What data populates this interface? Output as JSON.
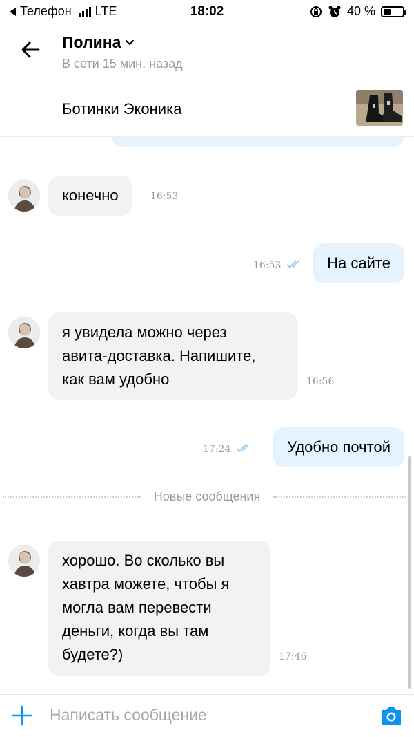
{
  "status_bar": {
    "carrier": "Телефон",
    "network": "LTE",
    "time": "18:02",
    "battery": "40 %",
    "battery_level": 0.4
  },
  "header": {
    "contact_name": "Полина",
    "contact_status": "В сети 15 мин. назад"
  },
  "item": {
    "title": "Ботинки Эконика"
  },
  "messages": [
    {
      "direction": "in",
      "text": "конечно",
      "time": "16:53"
    },
    {
      "direction": "out",
      "text": "На сайте",
      "time": "16:53",
      "read": true
    },
    {
      "direction": "in",
      "lines": [
        "я увидела можно через",
        "авита-доставка. Напишите,",
        "как вам удобно"
      ],
      "time": "16:56"
    },
    {
      "direction": "out",
      "text": "Удобно почтой",
      "time": "17:24",
      "read": true
    },
    {
      "direction": "in",
      "lines": [
        "хорошо. Во сколько вы",
        "хавтра можете, чтобы я",
        "могла вам перевести",
        "деньги, когда вы там",
        "будете?)"
      ],
      "time": "17:46"
    }
  ],
  "divider": {
    "label": "Новые сообщения"
  },
  "composer": {
    "placeholder": "Написать сообщение"
  },
  "colors": {
    "outgoing_bubble": "#e4f3fe",
    "incoming_bubble": "#f2f2f2",
    "accent": "#0a95f0",
    "read_checks": "#8fc9ef"
  }
}
